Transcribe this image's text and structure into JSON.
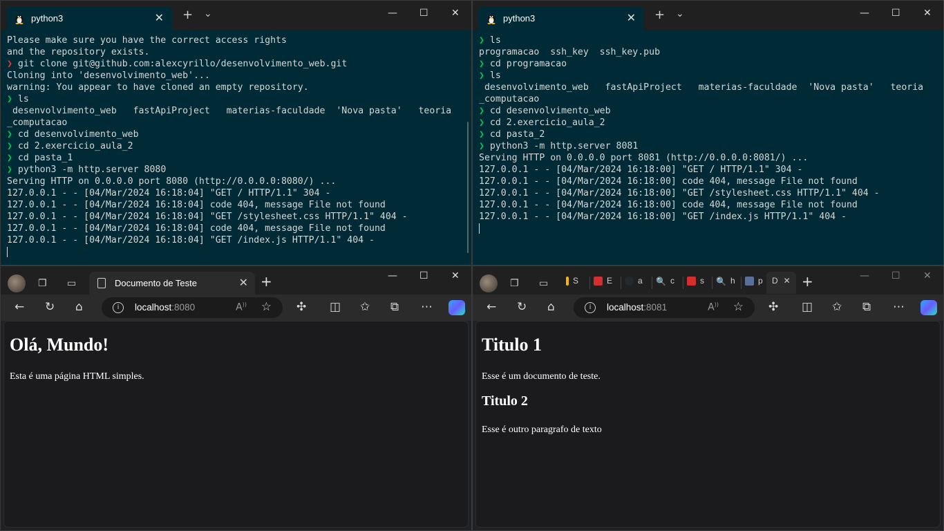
{
  "terminal_left": {
    "tab_title": "python3",
    "lines": [
      {
        "prompt": "",
        "text": "Please make sure you have the correct access rights"
      },
      {
        "prompt": "",
        "text": "and the repository exists."
      },
      {
        "prompt": "❯",
        "prompt_type": "err",
        "text": " git clone git@github.com:alexcyrillo/desenvolvimento_web.git"
      },
      {
        "prompt": "",
        "text": "Cloning into 'desenvolvimento_web'..."
      },
      {
        "prompt": "",
        "text": "warning: You appear to have cloned an empty repository."
      },
      {
        "prompt": "❯",
        "prompt_type": "ok",
        "text": " ls"
      },
      {
        "prompt": "",
        "text": " desenvolvimento_web   fastApiProject   materias-faculdade  'Nova pasta'   teoria"
      },
      {
        "prompt": "",
        "text": "_computacao"
      },
      {
        "prompt": "❯",
        "prompt_type": "ok",
        "text": " cd desenvolvimento_web"
      },
      {
        "prompt": "❯",
        "prompt_type": "ok",
        "text": " cd 2.exercicio_aula_2"
      },
      {
        "prompt": "❯",
        "prompt_type": "ok",
        "text": " cd pasta_1"
      },
      {
        "prompt": "❯",
        "prompt_type": "ok",
        "text": " python3 -m http.server 8080"
      },
      {
        "prompt": "",
        "text": "Serving HTTP on 0.0.0.0 port 8080 (http://0.0.0.0:8080/) ..."
      },
      {
        "prompt": "",
        "text": "127.0.0.1 - - [04/Mar/2024 16:18:04] \"GET / HTTP/1.1\" 304 -"
      },
      {
        "prompt": "",
        "text": "127.0.0.1 - - [04/Mar/2024 16:18:04] code 404, message File not found"
      },
      {
        "prompt": "",
        "text": "127.0.0.1 - - [04/Mar/2024 16:18:04] \"GET /stylesheet.css HTTP/1.1\" 404 -"
      },
      {
        "prompt": "",
        "text": "127.0.0.1 - - [04/Mar/2024 16:18:04] code 404, message File not found"
      },
      {
        "prompt": "",
        "text": "127.0.0.1 - - [04/Mar/2024 16:18:04] \"GET /index.js HTTP/1.1\" 404 -"
      }
    ]
  },
  "terminal_right": {
    "tab_title": "python3",
    "lines": [
      {
        "prompt": "❯",
        "prompt_type": "ok",
        "text": " ls"
      },
      {
        "prompt": "",
        "text": "programacao  ssh_key  ssh_key.pub"
      },
      {
        "prompt": "❯",
        "prompt_type": "ok",
        "text": " cd programacao"
      },
      {
        "prompt": "❯",
        "prompt_type": "ok",
        "text": " ls"
      },
      {
        "prompt": "",
        "text": " desenvolvimento_web   fastApiProject   materias-faculdade  'Nova pasta'   teoria"
      },
      {
        "prompt": "",
        "text": "_computacao"
      },
      {
        "prompt": "❯",
        "prompt_type": "ok",
        "text": " cd desenvolvimento_web"
      },
      {
        "prompt": "❯",
        "prompt_type": "ok",
        "text": " cd 2.exercicio_aula_2"
      },
      {
        "prompt": "❯",
        "prompt_type": "ok",
        "text": " cd pasta_2"
      },
      {
        "prompt": "❯",
        "prompt_type": "ok",
        "text": " python3 -m http.server 8081"
      },
      {
        "prompt": "",
        "text": "Serving HTTP on 0.0.0.0 port 8081 (http://0.0.0.0:8081/) ..."
      },
      {
        "prompt": "",
        "text": "127.0.0.1 - - [04/Mar/2024 16:18:00] \"GET / HTTP/1.1\" 304 -"
      },
      {
        "prompt": "",
        "text": "127.0.0.1 - - [04/Mar/2024 16:18:00] code 404, message File not found"
      },
      {
        "prompt": "",
        "text": "127.0.0.1 - - [04/Mar/2024 16:18:00] \"GET /stylesheet.css HTTP/1.1\" 404 -"
      },
      {
        "prompt": "",
        "text": "127.0.0.1 - - [04/Mar/2024 16:18:00] code 404, message File not found"
      },
      {
        "prompt": "",
        "text": "127.0.0.1 - - [04/Mar/2024 16:18:00] \"GET /index.js HTTP/1.1\" 404 -"
      }
    ]
  },
  "browser_left": {
    "tab_title": "Documento de Teste",
    "address_host": "localhost",
    "address_port": ":8080",
    "page": {
      "h1": "Olá, Mundo!",
      "p1": "Esta é uma página HTML simples."
    }
  },
  "browser_right": {
    "address_host": "localhost",
    "address_port": ":8081",
    "mini_tabs": [
      "S",
      "E",
      "a",
      "c",
      "s",
      "h",
      "p",
      "D"
    ],
    "page": {
      "h1": "Titulo 1",
      "p1": "Esse é um documento de teste.",
      "h2": "Titulo 2",
      "p2": "Esse é outro paragrafo de texto"
    }
  },
  "icons": {
    "minimize": "—",
    "maximize": "☐",
    "close": "✕",
    "new_tab": "+",
    "dropdown": "⌄",
    "back": "←",
    "refresh": "↻",
    "home": "⌂",
    "more": "⋯"
  },
  "colors": {
    "terminal_bg": "#002b36",
    "prompt_ok": "#00c853",
    "prompt_err": "#e53935"
  }
}
